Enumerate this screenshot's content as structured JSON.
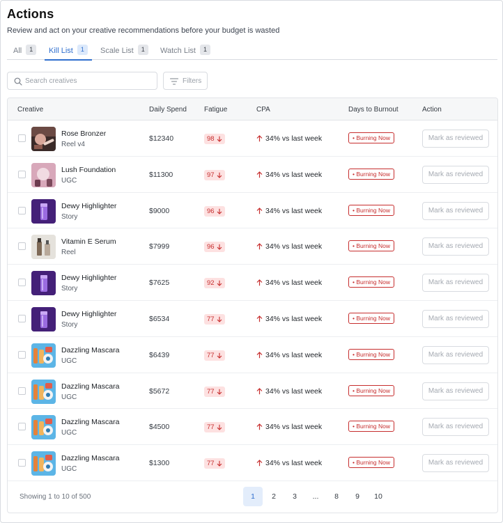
{
  "header": {
    "title": "Actions",
    "subtitle": "Review and act on your creative recommendations before your budget is wasted"
  },
  "tabs": [
    {
      "label": "All",
      "count": "1",
      "active": false
    },
    {
      "label": "Kill List",
      "count": "1",
      "active": true
    },
    {
      "label": "Scale List",
      "count": "1",
      "active": false
    },
    {
      "label": "Watch List",
      "count": "1",
      "active": false
    }
  ],
  "search": {
    "placeholder": "Search creatives",
    "value": ""
  },
  "filters": {
    "label": "Filters"
  },
  "table": {
    "columns": [
      "Creative",
      "Daily Spend",
      "Fatigue",
      "CPA",
      "Days to Burnout",
      "Action"
    ],
    "rows": [
      {
        "name": "Rose Bronzer",
        "type": "Reel v4",
        "thumb": "rose-bronzer-thumbnail",
        "spend": "$12340",
        "fatigue": "98",
        "cpa": "34% vs last week",
        "burnout": "• Burning Now",
        "action": "Mark as reviewed"
      },
      {
        "name": "Lush Foundation",
        "type": "UGC",
        "thumb": "lush-foundation-thumbnail",
        "spend": "$11300",
        "fatigue": "97",
        "cpa": "34% vs last week",
        "burnout": "• Burning Now",
        "action": "Mark as reviewed"
      },
      {
        "name": "Dewy Highlighter",
        "type": "Story",
        "thumb": "dewy-highlighter-thumbnail",
        "spend": "$9000",
        "fatigue": "96",
        "cpa": "34% vs last week",
        "burnout": "• Burning Now",
        "action": "Mark as reviewed"
      },
      {
        "name": "Vitamin E Serum",
        "type": "Reel",
        "thumb": "vitamin-e-serum-thumbnail",
        "spend": "$7999",
        "fatigue": "96",
        "cpa": "34% vs last week",
        "burnout": "• Burning Now",
        "action": "Mark as reviewed"
      },
      {
        "name": "Dewy Highlighter",
        "type": "Story",
        "thumb": "dewy-highlighter-thumbnail",
        "spend": "$7625",
        "fatigue": "92",
        "cpa": "34% vs last week",
        "burnout": "• Burning Now",
        "action": "Mark as reviewed"
      },
      {
        "name": "Dewy Highlighter",
        "type": "Story",
        "thumb": "dewy-highlighter-thumbnail",
        "spend": "$6534",
        "fatigue": "77",
        "cpa": "34% vs last week",
        "burnout": "• Burning Now",
        "action": "Mark as reviewed"
      },
      {
        "name": "Dazzling Mascara",
        "type": "UGC",
        "thumb": "dazzling-mascara-thumbnail",
        "spend": "$6439",
        "fatigue": "77",
        "cpa": "34% vs last week",
        "burnout": "• Burning Now",
        "action": "Mark as reviewed"
      },
      {
        "name": "Dazzling Mascara",
        "type": "UGC",
        "thumb": "dazzling-mascara-thumbnail",
        "spend": "$5672",
        "fatigue": "77",
        "cpa": "34% vs last week",
        "burnout": "• Burning Now",
        "action": "Mark as reviewed"
      },
      {
        "name": "Dazzling Mascara",
        "type": "UGC",
        "thumb": "dazzling-mascara-thumbnail",
        "spend": "$4500",
        "fatigue": "77",
        "cpa": "34% vs last week",
        "burnout": "• Burning Now",
        "action": "Mark as reviewed"
      },
      {
        "name": "Dazzling Mascara",
        "type": "UGC",
        "thumb": "dazzling-mascara-thumbnail",
        "spend": "$1300",
        "fatigue": "77",
        "cpa": "34% vs last week",
        "burnout": "• Burning Now",
        "action": "Mark as reviewed"
      }
    ]
  },
  "pagination": {
    "summary": "Showing 1 to 10 of 500",
    "pages": [
      "1",
      "2",
      "3",
      "...",
      "8",
      "9",
      "10"
    ],
    "current": "1"
  },
  "colors": {
    "accent": "#2f6fce",
    "danger": "#c62d2d",
    "danger_bg": "#fde1e1"
  }
}
